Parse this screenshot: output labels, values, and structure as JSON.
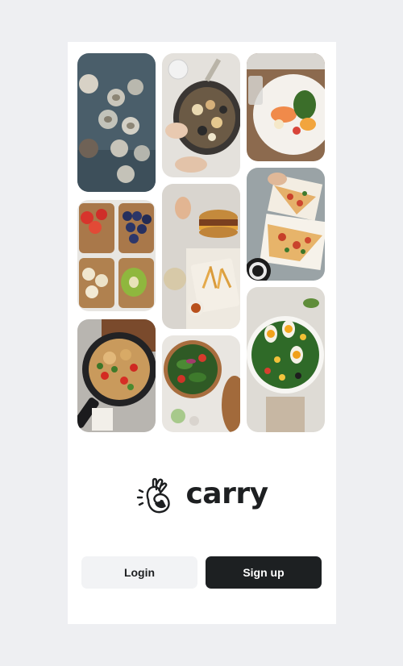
{
  "brand": {
    "name": "carry",
    "mark": "ok-hand-icon"
  },
  "gallery": {
    "images": [
      {
        "name": "oysters-photo"
      },
      {
        "name": "seafood-platter-photo"
      },
      {
        "name": "salmon-salad-photo"
      },
      {
        "name": "toast-bites-photo"
      },
      {
        "name": "burger-fries-photo"
      },
      {
        "name": "pizza-slices-photo"
      },
      {
        "name": "pasta-skillet-photo"
      },
      {
        "name": "green-salad-photo"
      },
      {
        "name": "egg-salad-photo"
      }
    ]
  },
  "actions": {
    "login_label": "Login",
    "signup_label": "Sign up"
  },
  "colors": {
    "background": "#eeeff2",
    "card": "#ffffff",
    "primary": "#1d2022",
    "secondary": "#f2f3f5"
  }
}
